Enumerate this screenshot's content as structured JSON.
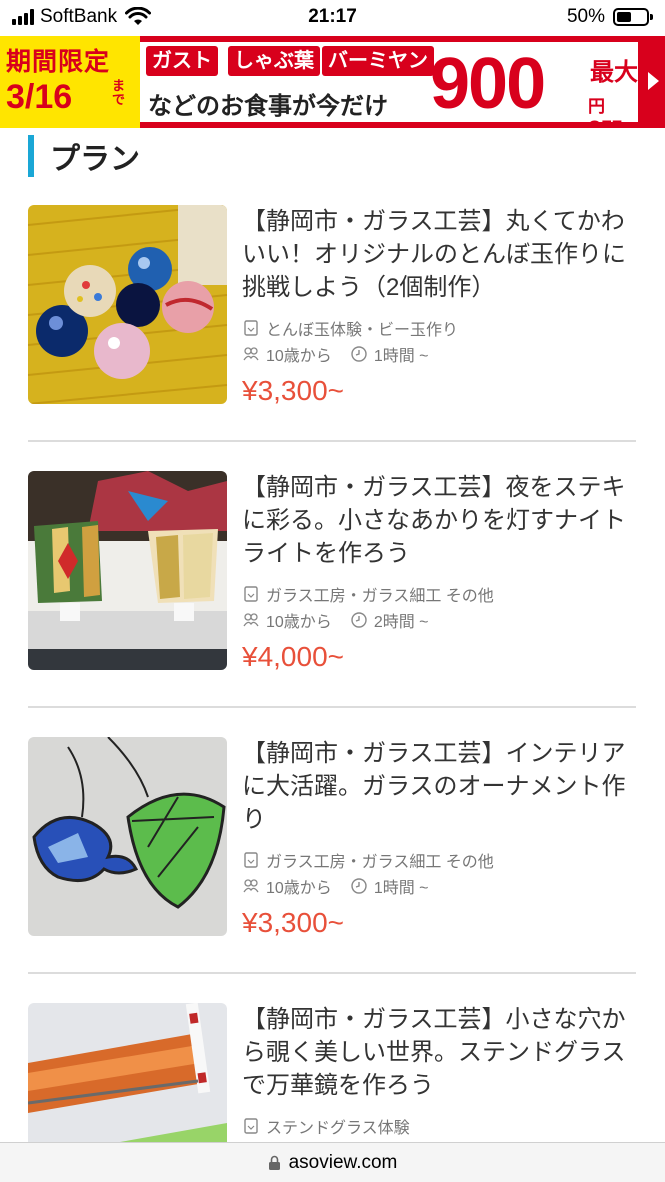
{
  "status_bar": {
    "carrier": "SoftBank",
    "time": "21:17",
    "battery": "50%",
    "battery_level": 0.5
  },
  "banner": {
    "left_line1": "期間限定",
    "left_line2": "3/16",
    "left_made": "まで",
    "tags": [
      "ガスト",
      "しゃぶ葉",
      "バーミヤン"
    ],
    "subtitle": "などのお食事が今だけ",
    "big_number": "900",
    "max_label": "最大",
    "off_label": "円OFF",
    "accent_color": "#d8001c",
    "yellow_color": "#ffe500"
  },
  "section": {
    "title": "プラン",
    "accent_color": "#1aa7d6"
  },
  "plans": [
    {
      "title": "【静岡市・ガラス工芸】丸くてかわいい！オリジナルのとんぼ玉作りに挑戦しよう（2個制作）",
      "category": "とんぼ玉体験・ビー玉作り",
      "age": "10歳から",
      "duration": "1時間 ~",
      "price": "¥3,300",
      "price_suffix": "~",
      "image": "glass-marbles-photo"
    },
    {
      "title": "【静岡市・ガラス工芸】夜をステキに彩る。小さなあかりを灯すナイトライトを作ろう",
      "category": "ガラス工房・ガラス細工 その他",
      "age": "10歳から",
      "duration": "2時間 ~",
      "price": "¥4,000",
      "price_suffix": "~",
      "image": "stained-glass-night-lights-photo"
    },
    {
      "title": "【静岡市・ガラス工芸】インテリアに大活躍。ガラスのオーナメント作り",
      "category": "ガラス工房・ガラス細工 その他",
      "age": "10歳から",
      "duration": "1時間 ~",
      "price": "¥3,300",
      "price_suffix": "~",
      "image": "glass-ornaments-photo"
    },
    {
      "title": "【静岡市・ガラス工芸】小さな穴から覗く美しい世界。ステンドグラスで万華鏡を作ろう",
      "category": "ステンドグラス体験",
      "image": "stained-glass-kaleidoscope-photo"
    }
  ],
  "url_bar": {
    "url": "asoview.com"
  },
  "price_color": "#e8503a"
}
